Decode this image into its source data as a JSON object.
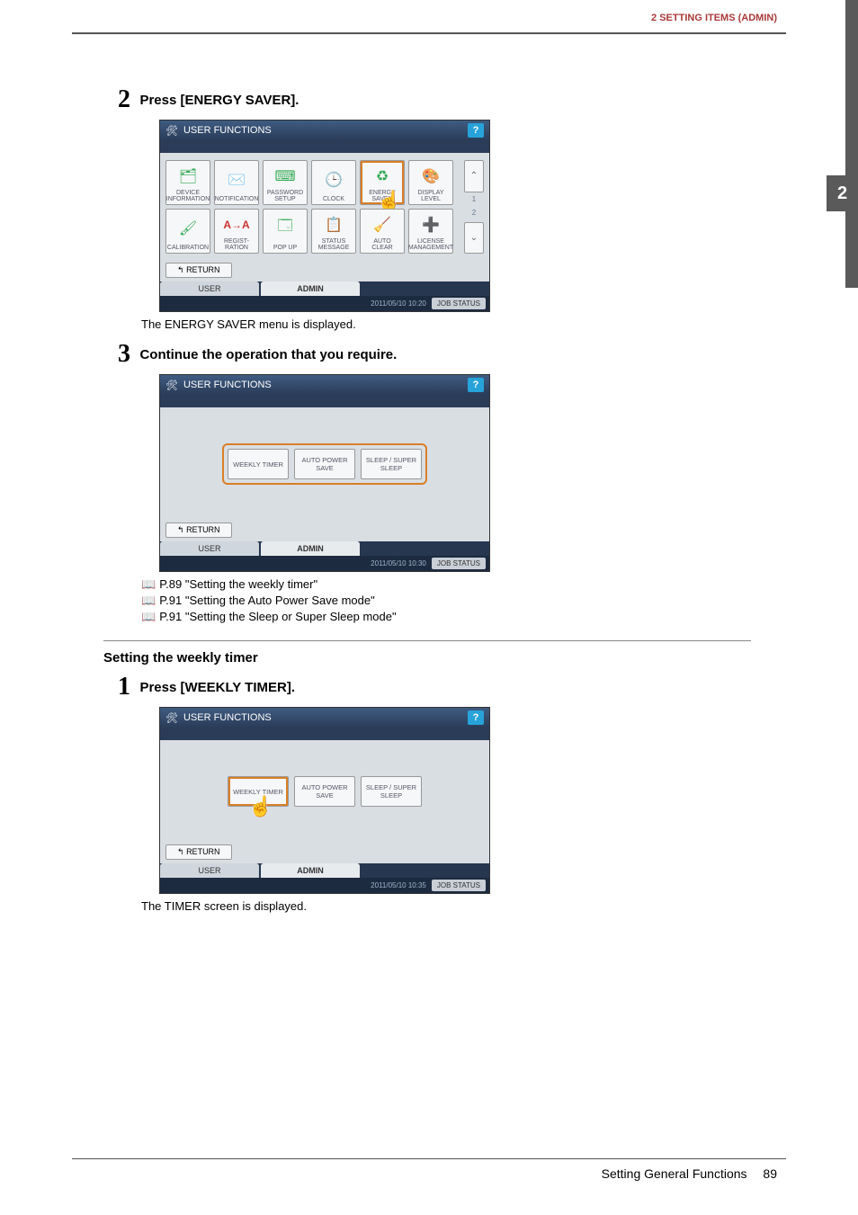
{
  "header": {
    "section_title": "2 SETTING ITEMS (ADMIN)",
    "right_tab": "2"
  },
  "step2": {
    "number": "2",
    "title": "Press [ENERGY SAVER].",
    "result": "The ENERGY SAVER menu is displayed.",
    "ui": {
      "title": "USER FUNCTIONS",
      "tiles": [
        "DEVICE INFORMATION",
        "NOTIFICATION",
        "PASSWORD SETUP",
        "CLOCK",
        "ENERGY SAVER",
        "DISPLAY LEVEL",
        "CALIBRATION",
        "REGIST- RATION",
        "POP UP",
        "STATUS MESSAGE",
        "AUTO CLEAR",
        "LICENSE MANAGEMENT"
      ],
      "selected_index": 4,
      "pager": {
        "page": "1",
        "total": "2",
        "up": "⌃",
        "down": "⌄"
      },
      "return": "RETURN",
      "tabs": [
        "USER",
        "ADMIN"
      ],
      "active_tab": 1,
      "timestamp": "2011/05/10 10:20",
      "job_status": "JOB STATUS"
    }
  },
  "step3": {
    "number": "3",
    "title": "Continue the operation that you require.",
    "ui": {
      "title": "USER FUNCTIONS",
      "buttons": [
        "WEEKLY TIMER",
        "AUTO POWER SAVE",
        "SLEEP / SUPER SLEEP"
      ],
      "return": "RETURN",
      "tabs": [
        "USER",
        "ADMIN"
      ],
      "active_tab": 1,
      "timestamp": "2011/05/10 10:30",
      "job_status": "JOB STATUS"
    },
    "refs": [
      "P.89 \"Setting the weekly timer\"",
      "P.91 \"Setting the Auto Power Save mode\"",
      "P.91 \"Setting the Sleep or Super Sleep mode\""
    ]
  },
  "subsection": {
    "title": "Setting the weekly timer"
  },
  "step1b": {
    "number": "1",
    "title": "Press [WEEKLY TIMER].",
    "result": "The TIMER screen is displayed.",
    "ui": {
      "title": "USER FUNCTIONS",
      "buttons": [
        "WEEKLY TIMER",
        "AUTO POWER SAVE",
        "SLEEP / SUPER SLEEP"
      ],
      "selected_index": 0,
      "return": "RETURN",
      "tabs": [
        "USER",
        "ADMIN"
      ],
      "active_tab": 1,
      "timestamp": "2011/05/10 10:35",
      "job_status": "JOB STATUS"
    }
  },
  "footer": {
    "text": "Setting General Functions",
    "page": "89"
  },
  "icons": {
    "help": "?",
    "return_arrow": "↰",
    "book": "📖"
  }
}
